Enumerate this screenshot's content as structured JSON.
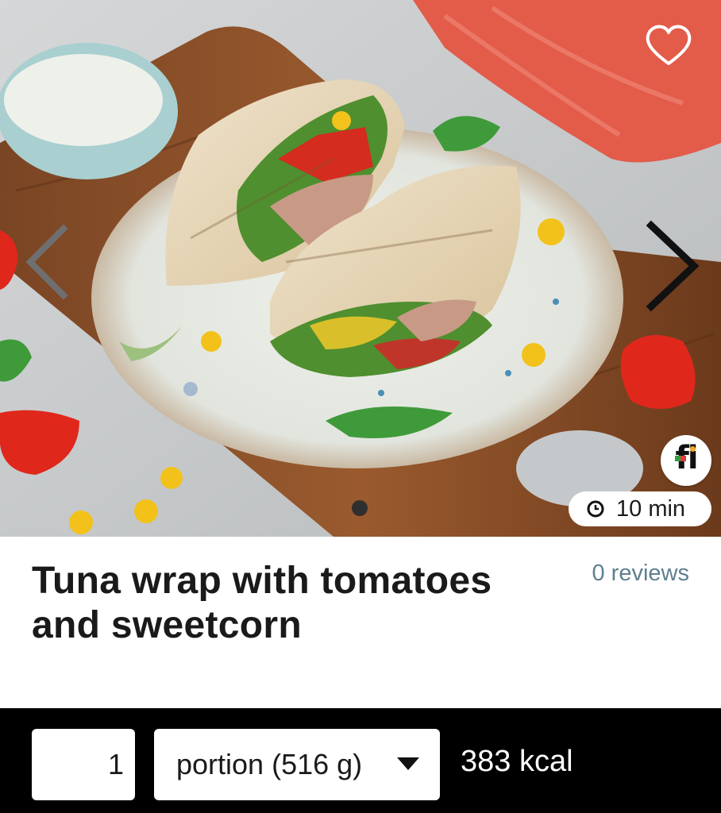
{
  "hero": {
    "favorite_icon": "heart-outline-icon",
    "prev_icon": "chevron-left-icon",
    "next_icon": "chevron-right-icon",
    "brand_logo_text": "fi",
    "brand_logo_colors": [
      "#2e9e3f",
      "#e53935",
      "#f5a623"
    ],
    "carousel_dots": 1,
    "cook_time": "10 min"
  },
  "recipe": {
    "title": "Tuna wrap with tomatoes and sweetcorn",
    "reviews": "0 reviews"
  },
  "footer": {
    "quantity": "1",
    "portion_unit": "portion (516 g)",
    "calories": "383 kcal"
  },
  "colors": {
    "reviews_link": "#5f7f8f",
    "footer_background": "#000000"
  }
}
